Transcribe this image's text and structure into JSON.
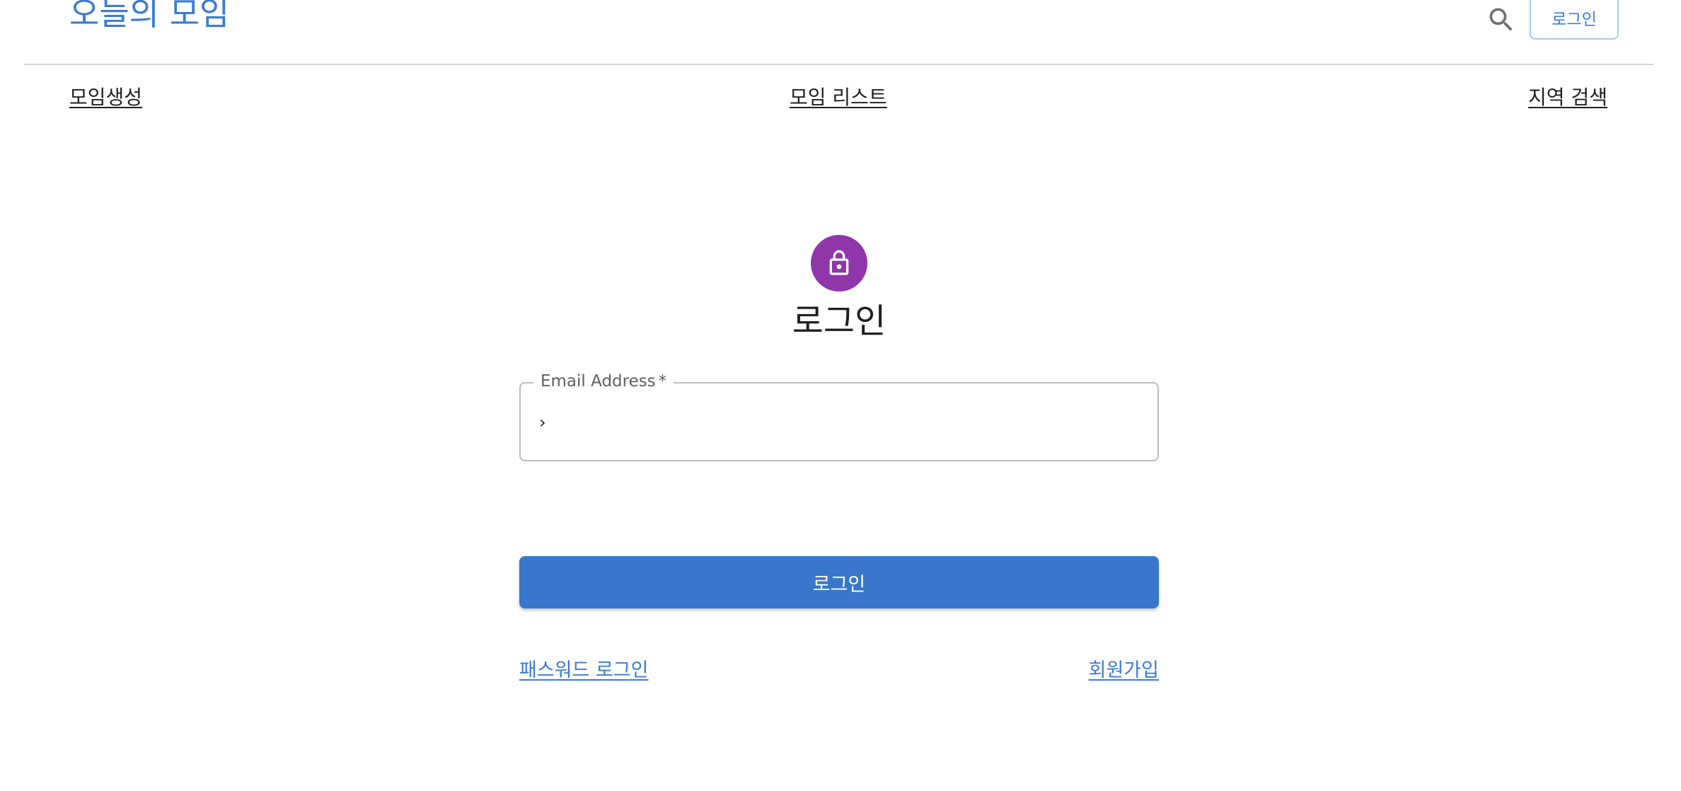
{
  "header": {
    "site_title": "오늘의 모임",
    "search_icon": "search-icon",
    "login_button": "로그인",
    "accent_color": "#3a7bd5"
  },
  "nav": {
    "create": "모임생성",
    "list": "모임 리스트",
    "region_search": "지역 검색"
  },
  "login_form": {
    "avatar_icon": "lock-icon",
    "avatar_color": "#8e36aa",
    "heading": "로그인",
    "email": {
      "label": "Email Address",
      "required_mark": "*",
      "value": "›"
    },
    "submit_label": "로그인",
    "password_login_link": "패스워드 로그인",
    "signup_link": "회원가입"
  }
}
